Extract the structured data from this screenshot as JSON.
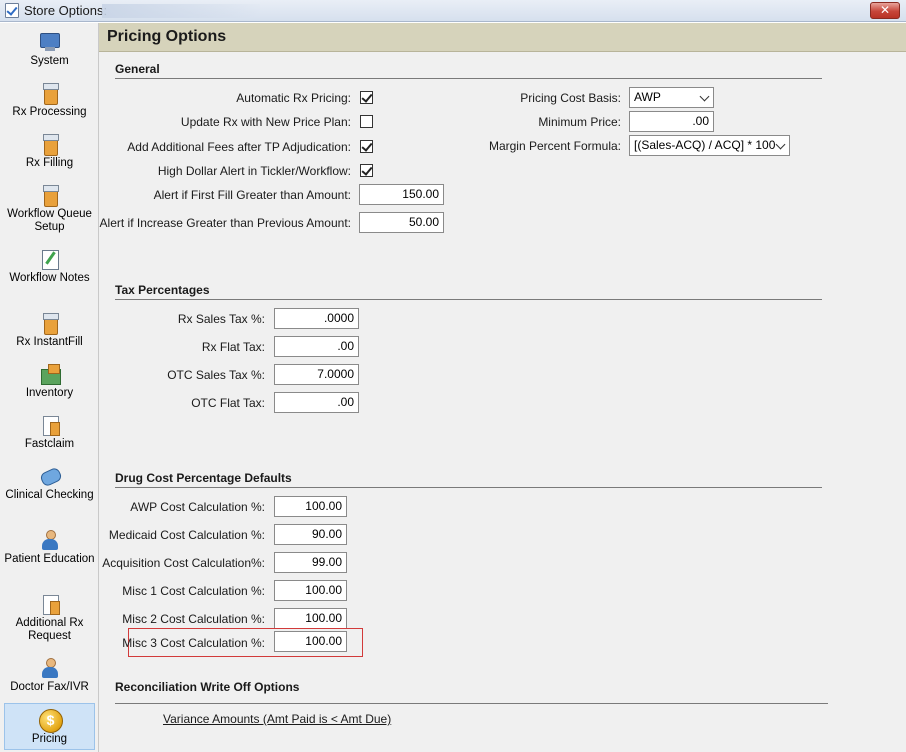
{
  "window": {
    "title": "Store Options:",
    "close_label": "✕"
  },
  "sidebar": {
    "items": [
      {
        "label": "System",
        "icon": "computer-icon"
      },
      {
        "label": "Rx Processing",
        "icon": "prescription-bottle-icon"
      },
      {
        "label": "Rx Filling",
        "icon": "prescription-bottle-icon"
      },
      {
        "label": "Workflow Queue Setup",
        "icon": "queue-bottle-icon"
      },
      {
        "label": "Workflow Notes",
        "icon": "notepad-icon"
      },
      {
        "label": "Rx InstantFill",
        "icon": "instantfill-bottle-icon"
      },
      {
        "label": "Inventory",
        "icon": "inventory-box-icon"
      },
      {
        "label": "Fastclaim",
        "icon": "claim-document-icon"
      },
      {
        "label": "Clinical Checking",
        "icon": "pill-icon"
      },
      {
        "label": "Patient Education",
        "icon": "people-icon"
      },
      {
        "label": "Additional Rx Request",
        "icon": "rx-request-icon"
      },
      {
        "label": "Doctor Fax/IVR",
        "icon": "doctor-icon"
      },
      {
        "label": "Pricing",
        "icon": "dollar-coin-icon",
        "active": true
      }
    ]
  },
  "page": {
    "title": "Pricing Options"
  },
  "general": {
    "title": "General",
    "automatic_rx_pricing": {
      "label": "Automatic Rx Pricing:",
      "checked": true
    },
    "update_rx_price_plan": {
      "label": "Update Rx with New Price Plan:",
      "checked": false
    },
    "add_fees_tp": {
      "label": "Add Additional Fees after TP Adjudication:",
      "checked": true
    },
    "high_dollar_alert": {
      "label": "High Dollar Alert in Tickler/Workflow:",
      "checked": true
    },
    "first_fill_alert": {
      "label": "Alert if First Fill Greater than Amount:",
      "value": "150.00"
    },
    "increase_alert": {
      "label": "Alert if Increase Greater than Previous Amount:",
      "value": "50.00"
    },
    "pricing_cost_basis": {
      "label": "Pricing Cost Basis:",
      "value": "AWP"
    },
    "minimum_price": {
      "label": "Minimum Price:",
      "value": ".00"
    },
    "margin_formula": {
      "label": "Margin Percent Formula:",
      "value": "[(Sales-ACQ) / ACQ] * 100"
    }
  },
  "tax": {
    "title": "Tax Percentages",
    "rx_sales_tax": {
      "label": "Rx Sales Tax %:",
      "value": ".0000"
    },
    "rx_flat_tax": {
      "label": "Rx Flat Tax:",
      "value": ".00"
    },
    "otc_sales_tax": {
      "label": "OTC Sales Tax %:",
      "value": "7.0000"
    },
    "otc_flat_tax": {
      "label": "OTC Flat Tax:",
      "value": ".00"
    }
  },
  "drug_cost": {
    "title": "Drug Cost Percentage Defaults",
    "awp": {
      "label": "AWP Cost Calculation %:",
      "value": "100.00"
    },
    "medicaid": {
      "label": "Medicaid Cost Calculation %:",
      "value": "90.00"
    },
    "acquisition": {
      "label": "Acquisition Cost Calculation%:",
      "value": "99.00"
    },
    "misc1": {
      "label": "Misc 1 Cost Calculation %:",
      "value": "100.00"
    },
    "misc2": {
      "label": "Misc 2 Cost Calculation %:",
      "value": "100.00"
    },
    "misc3": {
      "label": "Misc 3 Cost Calculation %:",
      "value": "100.00"
    }
  },
  "reconciliation": {
    "title": "Reconciliation Write Off Options",
    "variance_link": "Variance Amounts (Amt Paid is < Amt Due)"
  },
  "colors": {
    "header_band": "#d6d3bb",
    "highlight_border": "#d23a3a",
    "active_nav": "#cfe3f7"
  }
}
